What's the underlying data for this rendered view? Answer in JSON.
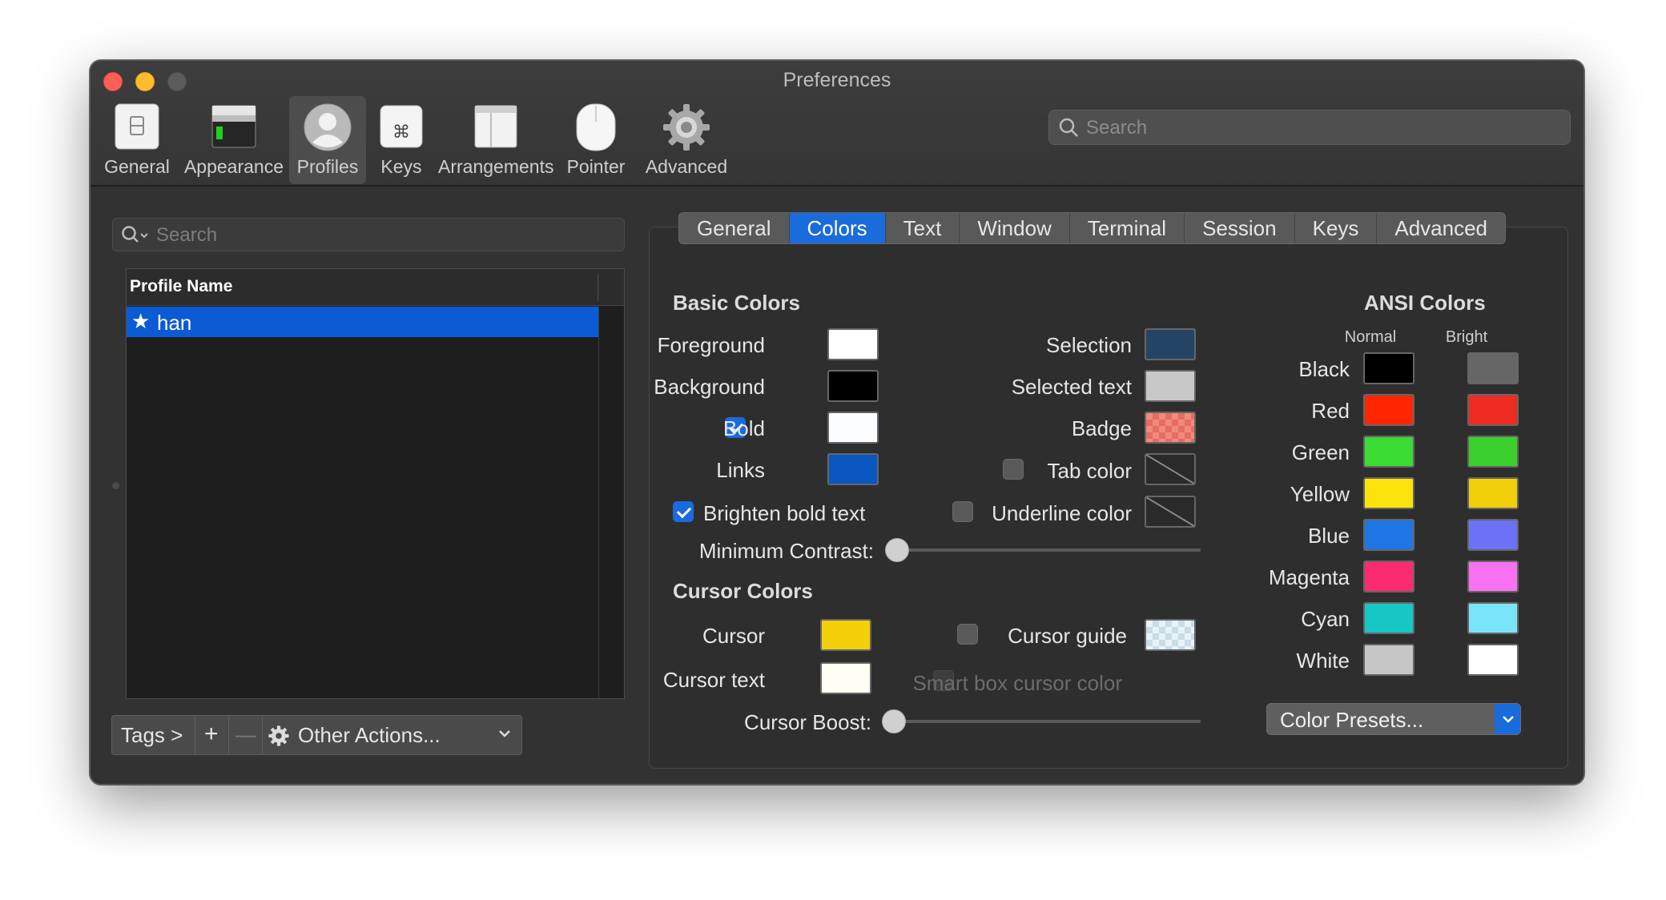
{
  "window": {
    "title": "Preferences"
  },
  "toolbar": {
    "items": [
      {
        "label": "General",
        "icon": "general-switch-icon"
      },
      {
        "label": "Appearance",
        "icon": "appearance-window-icon"
      },
      {
        "label": "Profiles",
        "icon": "profile-person-icon",
        "selected": true
      },
      {
        "label": "Keys",
        "icon": "command-key-icon"
      },
      {
        "label": "Arrangements",
        "icon": "window-arrangement-icon"
      },
      {
        "label": "Pointer",
        "icon": "mouse-icon"
      },
      {
        "label": "Advanced",
        "icon": "gear-icon"
      }
    ],
    "search_placeholder": "Search"
  },
  "profiles": {
    "search_placeholder": "Search",
    "column_header": "Profile Name",
    "items": [
      {
        "name": "han",
        "default": true
      }
    ],
    "bottom": {
      "tags": "Tags >",
      "add": "+",
      "remove": "—",
      "other_actions": "Other Actions..."
    }
  },
  "tabs": [
    "General",
    "Colors",
    "Text",
    "Window",
    "Terminal",
    "Session",
    "Keys",
    "Advanced"
  ],
  "active_tab": "Colors",
  "basic_colors": {
    "heading": "Basic Colors",
    "foreground": {
      "label": "Foreground",
      "color": "#ffffff"
    },
    "background": {
      "label": "Background",
      "color": "#000000"
    },
    "bold": {
      "label": "Bold",
      "color": "#fbfdff",
      "checked": true
    },
    "links": {
      "label": "Links",
      "color": "#0a57c2"
    },
    "selection": {
      "label": "Selection",
      "color": "#244466"
    },
    "selected_text": {
      "label": "Selected text",
      "color": "#c8c8c8"
    },
    "badge": {
      "label": "Badge"
    },
    "tab_color": {
      "label": "Tab color",
      "checked": false
    },
    "brighten_bold": {
      "label": "Brighten bold text",
      "checked": true
    },
    "underline_color": {
      "label": "Underline color",
      "checked": false
    },
    "min_contrast": {
      "label": "Minimum Contrast:",
      "value": 0
    }
  },
  "cursor_colors": {
    "heading": "Cursor Colors",
    "cursor": {
      "label": "Cursor",
      "color": "#f5cf0a"
    },
    "cursor_text": {
      "label": "Cursor text",
      "color": "#fffef4"
    },
    "cursor_guide": {
      "label": "Cursor guide",
      "checked": false
    },
    "smart_box": {
      "label": "Smart box cursor color",
      "checked": false,
      "disabled": true
    },
    "cursor_boost": {
      "label": "Cursor Boost:",
      "value": 0
    }
  },
  "ansi": {
    "heading": "ANSI Colors",
    "normal_label": "Normal",
    "bright_label": "Bright",
    "rows": [
      {
        "name": "Black",
        "normal": "#000000",
        "bright": "#666666"
      },
      {
        "name": "Red",
        "normal": "#ff2600",
        "bright": "#ef2a20"
      },
      {
        "name": "Green",
        "normal": "#3bdc34",
        "bright": "#39d02e"
      },
      {
        "name": "Yellow",
        "normal": "#fde30c",
        "bright": "#f1cf0a"
      },
      {
        "name": "Blue",
        "normal": "#1e76e5",
        "bright": "#6b72f5"
      },
      {
        "name": "Magenta",
        "normal": "#fb2a71",
        "bright": "#f771f2"
      },
      {
        "name": "Cyan",
        "normal": "#17c7c6",
        "bright": "#7ae4f8"
      },
      {
        "name": "White",
        "normal": "#c6c6c6",
        "bright": "#ffffff"
      }
    ],
    "presets_label": "Color Presets..."
  }
}
